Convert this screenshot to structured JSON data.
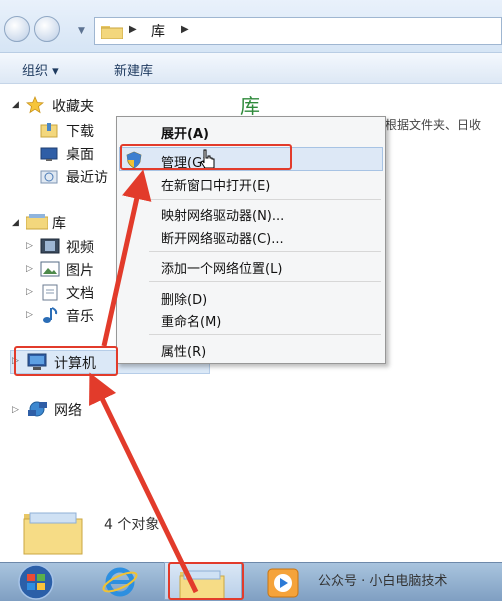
{
  "address": {
    "location": "库"
  },
  "toolbar": {
    "organize": "组织",
    "new_library": "新建库"
  },
  "sidebar": {
    "favorites": {
      "label": "收藏夹",
      "items": [
        "下载",
        "桌面",
        "最近访"
      ]
    },
    "libraries": {
      "label": "库",
      "items": [
        "视频",
        "图片",
        "文档",
        "音乐"
      ]
    },
    "computer": "计算机",
    "network": "网络"
  },
  "content": {
    "title": "库",
    "description": "根据文件夹、日收"
  },
  "context_menu": {
    "items": [
      "展开(A)",
      "管理(G)",
      "在新窗口中打开(E)",
      "映射网络驱动器(N)...",
      "断开网络驱动器(C)...",
      "添加一个网络位置(L)",
      "删除(D)",
      "重命名(M)",
      "属性(R)"
    ]
  },
  "details": {
    "count": "4 个对象"
  },
  "watermark": "公众号 · 小白电脑技术",
  "colors": {
    "annotation_red": "#e23b2b",
    "lib_title_green": "#2f8a3b"
  }
}
